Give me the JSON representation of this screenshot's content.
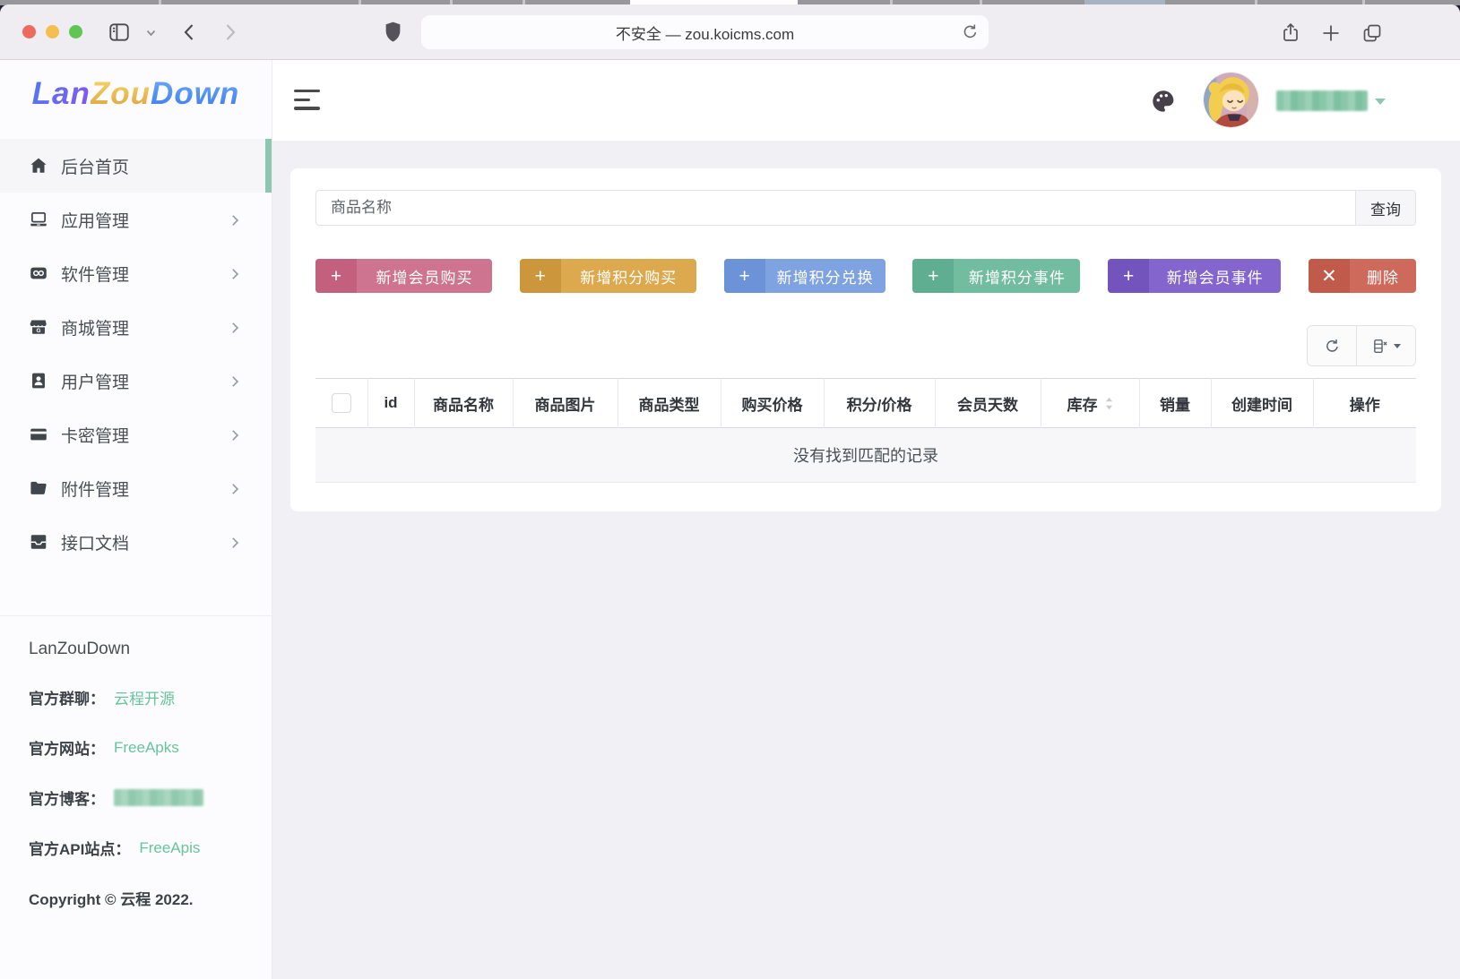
{
  "browser": {
    "address_bar": {
      "text": "不安全 — zou.koicms.com"
    },
    "controls": [
      "close",
      "minimize",
      "zoom",
      "sidebar-toggle",
      "back",
      "forward",
      "privacy-shield",
      "reload",
      "share",
      "new-tab",
      "tab-overview"
    ]
  },
  "sidebar": {
    "logo": {
      "part1": "Lan",
      "part2": "Zou",
      "part3": "Down"
    },
    "accent_color": "#8cc8b0",
    "items": [
      {
        "label": "后台首页",
        "icon": "home-icon",
        "active": true,
        "has_submenu": false
      },
      {
        "label": "应用管理",
        "icon": "app-icon",
        "has_submenu": true
      },
      {
        "label": "软件管理",
        "icon": "software-icon",
        "has_submenu": true
      },
      {
        "label": "商城管理",
        "icon": "mall-icon",
        "has_submenu": true
      },
      {
        "label": "用户管理",
        "icon": "user-icon",
        "has_submenu": true
      },
      {
        "label": "卡密管理",
        "icon": "card-key-icon",
        "has_submenu": true
      },
      {
        "label": "附件管理",
        "icon": "attachment-icon",
        "has_submenu": true
      },
      {
        "label": "接口文档",
        "icon": "api-docs-icon",
        "has_submenu": true
      }
    ],
    "footer": {
      "app_name": "LanZouDown",
      "rows": [
        {
          "label": "官方群聊：",
          "link": "云程开源",
          "redacted": false
        },
        {
          "label": "官方网站：",
          "link": "FreeApks",
          "redacted": false
        },
        {
          "label": "官方博客：",
          "link": "",
          "redacted": true
        },
        {
          "label": "官方API站点：",
          "link": "FreeApis",
          "redacted": false
        }
      ],
      "copyright": "Copyright © 云程 2022.",
      "link_color": "#67c49a"
    }
  },
  "header": {
    "icons": [
      "hamburger-menu-icon",
      "palette-icon",
      "user-avatar",
      "caret-down-icon"
    ],
    "username_redacted": true
  },
  "content": {
    "search": {
      "placeholder": "商品名称",
      "button_label": "查询"
    },
    "actions": [
      {
        "label": "新增会员购买",
        "glyph": "+",
        "color": "#ce7490",
        "icon_bg": "#c2607e"
      },
      {
        "label": "新增积分购买",
        "glyph": "+",
        "color": "#dca94f",
        "icon_bg": "#cb963c"
      },
      {
        "label": "新增积分兑换",
        "glyph": "+",
        "color": "#7fa3e1",
        "icon_bg": "#6c92d8"
      },
      {
        "label": "新增积分事件",
        "glyph": "+",
        "color": "#72bda0",
        "icon_bg": "#5fae92"
      },
      {
        "label": "新增会员事件",
        "glyph": "+",
        "color": "#8465cd",
        "icon_bg": "#7254bc"
      },
      {
        "label": "删除",
        "glyph": "✕",
        "color": "#cd6a5c",
        "icon_bg": "#c05a4b"
      }
    ],
    "table": {
      "headers": [
        "",
        "id",
        "商品名称",
        "商品图片",
        "商品类型",
        "购买价格",
        "积分/价格",
        "会员天数",
        "库存",
        "销量",
        "创建时间",
        "操作"
      ],
      "sortable_column": "库存",
      "empty_text": "没有找到匹配的记录"
    }
  }
}
